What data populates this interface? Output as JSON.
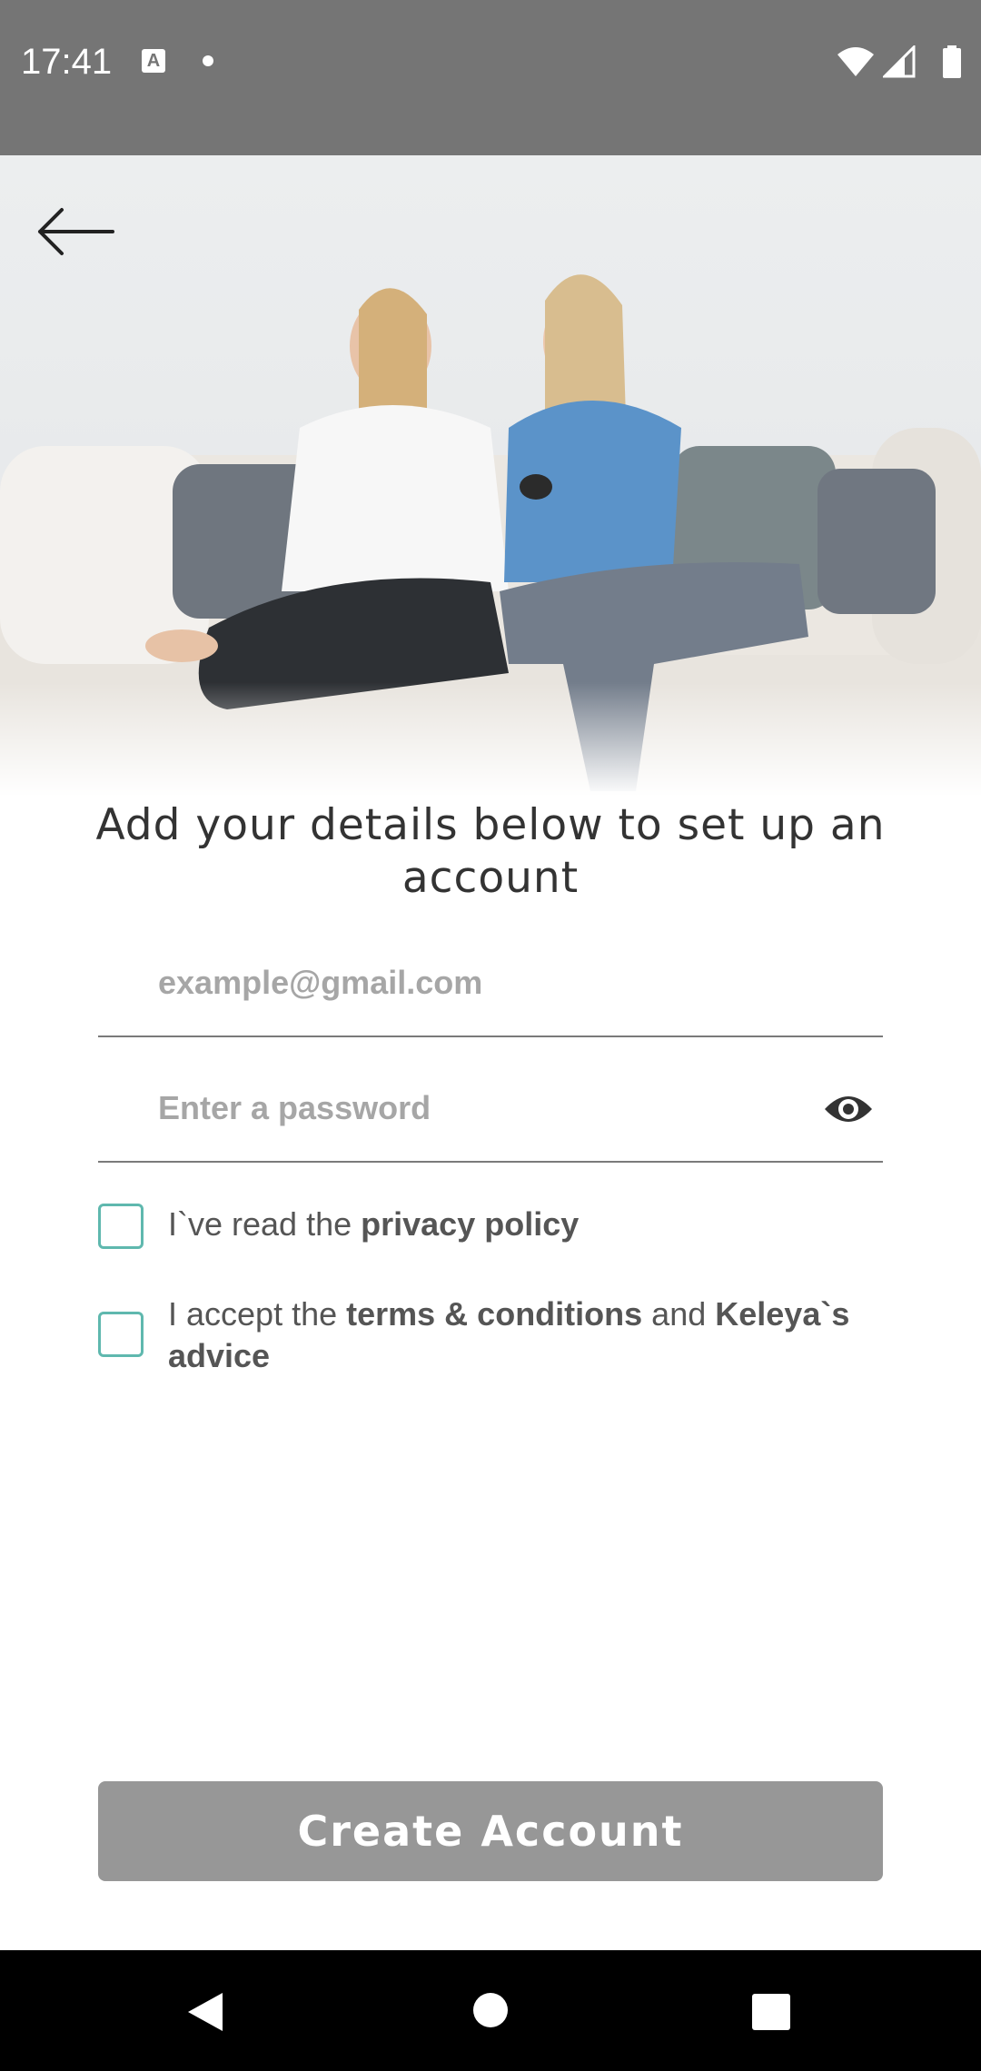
{
  "status_bar": {
    "time": "17:41",
    "notification_icon_letter": "A"
  },
  "hero": {
    "image_description_icon": "photo-two-pregnant-women-on-sofa"
  },
  "main": {
    "heading": "Add your details below to set up an account",
    "email": {
      "placeholder": "example@gmail.com",
      "value": ""
    },
    "password": {
      "placeholder": "Enter a password",
      "value": ""
    },
    "privacy": {
      "prefix": "I`ve read the ",
      "bold": "privacy policy"
    },
    "terms": {
      "prefix": "I accept the ",
      "bold1": "terms & conditions",
      "middle": " and ",
      "bold2": "Keleya`s advice"
    },
    "create_button_label": "Create Account"
  },
  "colors": {
    "status_bar": "#757575",
    "checkbox_border": "#5fb8ae",
    "button_disabled": "#979797",
    "nav_bar": "#000000"
  }
}
